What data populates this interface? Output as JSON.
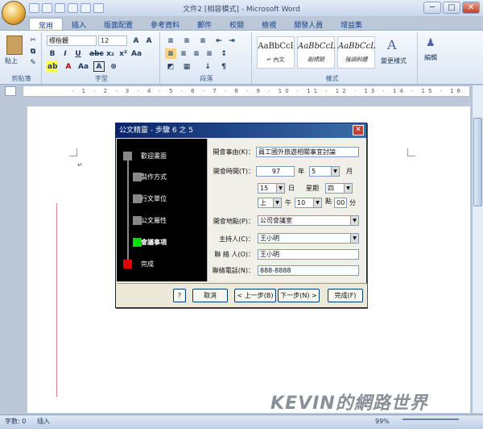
{
  "window": {
    "title": "文件2 [相容模式] - Microsoft Word",
    "min": "─",
    "max": "□",
    "close": "✕"
  },
  "tabs": [
    "常用",
    "插入",
    "版面配置",
    "參考資料",
    "郵件",
    "校閱",
    "檢視",
    "開發人員",
    "增益集"
  ],
  "ribbon": {
    "clipboard": {
      "paste": "貼上",
      "label": "剪貼簿"
    },
    "font": {
      "name": "標楷體",
      "size": "12",
      "label": "字型"
    },
    "paragraph": {
      "label": "段落"
    },
    "styles": {
      "label": "樣式",
      "items": [
        {
          "preview": "AaBbCcI",
          "name": "↵ 內文"
        },
        {
          "preview": "AaBbCcL",
          "name": "副標題"
        },
        {
          "preview": "AaBbCcL",
          "name": "強調斜體"
        }
      ],
      "change": "變更樣式"
    },
    "editing": {
      "label": "編輯"
    }
  },
  "dialog": {
    "title": "公文精靈 - 步驟 6 之 5",
    "steps": [
      "歡迎畫面",
      "製作方式",
      "行文單位",
      "公文屬性",
      "會議事項",
      "完成"
    ],
    "fields": {
      "subject_label": "開會事由(K)：",
      "subject": "員工國外旅遊相關事宜討論",
      "time_label": "開會時間(T)：",
      "year": "97",
      "year_unit": "年",
      "month": "5",
      "month_unit": "月",
      "day": "15",
      "day_unit": "日",
      "weekday_label": "星期",
      "weekday": "四",
      "ampm": "上",
      "noon_unit": "午",
      "hour": "10",
      "hour_unit": "點",
      "minute": "00",
      "minute_unit": "分",
      "place_label": "開會地點(P)：",
      "place": "公司會議室",
      "host_label": "主持人(C)：",
      "host": "王小明",
      "contact_label": "聯 絡 人(O)：",
      "contact": "王小明",
      "phone_label": "聯絡電話(N)：",
      "phone": "888-8888"
    },
    "buttons": {
      "help": "?",
      "cancel": "取消",
      "prev": "< 上一步(B)",
      "next": "下一步(N) >",
      "finish": "完成(F)"
    }
  },
  "status": {
    "pages": "字數: 0",
    "mode": "插入",
    "zoom": "99%"
  },
  "watermark": "KEVIN的網路世界"
}
